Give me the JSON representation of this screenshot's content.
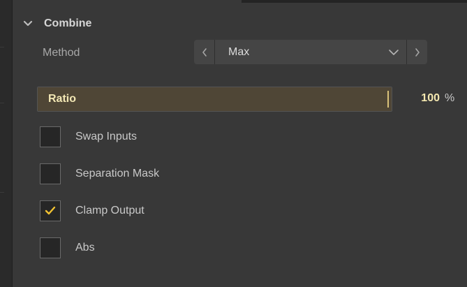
{
  "section": {
    "title": "Combine",
    "expanded": true
  },
  "method": {
    "label": "Method",
    "value": "Max"
  },
  "ratio": {
    "label": "Ratio",
    "value": "100",
    "unit": "%",
    "fraction": 1.0
  },
  "options": [
    {
      "label": "Swap Inputs",
      "checked": false
    },
    {
      "label": "Separation Mask",
      "checked": false
    },
    {
      "label": "Clamp Output",
      "checked": true
    },
    {
      "label": "Abs",
      "checked": false
    }
  ],
  "colors": {
    "accent": "#f1c232",
    "slider_fill": "#4f4636",
    "panel_bg": "#383838"
  },
  "icons": {
    "collapse": "chevron-down-icon",
    "prev": "chevron-left-icon",
    "next": "chevron-right-icon",
    "dropdown": "chevron-down-icon",
    "check": "checkmark-icon"
  }
}
